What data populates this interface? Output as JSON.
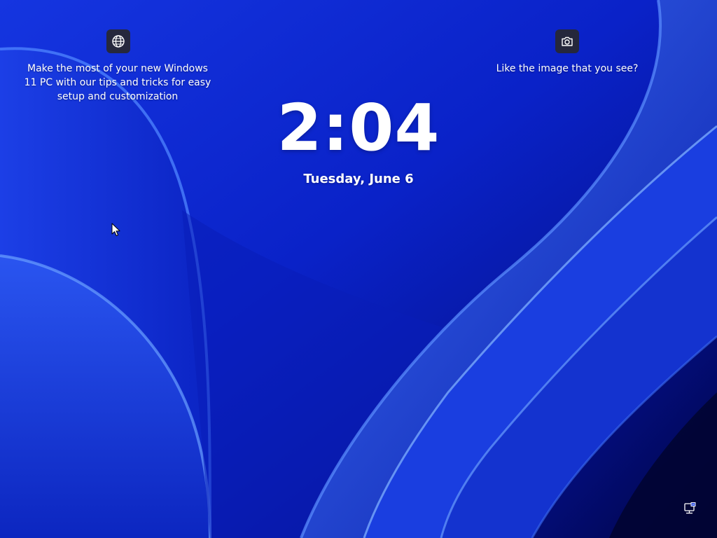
{
  "lock_screen": {
    "time": "2:04",
    "date": "Tuesday, June 6"
  },
  "spotlight": {
    "tip": {
      "icon": "globe-icon",
      "line1": "Make the most of your new Windows",
      "line2": "11 PC with our tips and tricks for easy",
      "line3": "setup and customization"
    },
    "like_image": {
      "icon": "camera-icon",
      "text": "Like the image that you see?"
    }
  },
  "status": {
    "network_icon": "network-ethernet-icon"
  },
  "colors": {
    "background": "#0a1fd0",
    "tile": "#28282f",
    "text": "#ffffff"
  }
}
